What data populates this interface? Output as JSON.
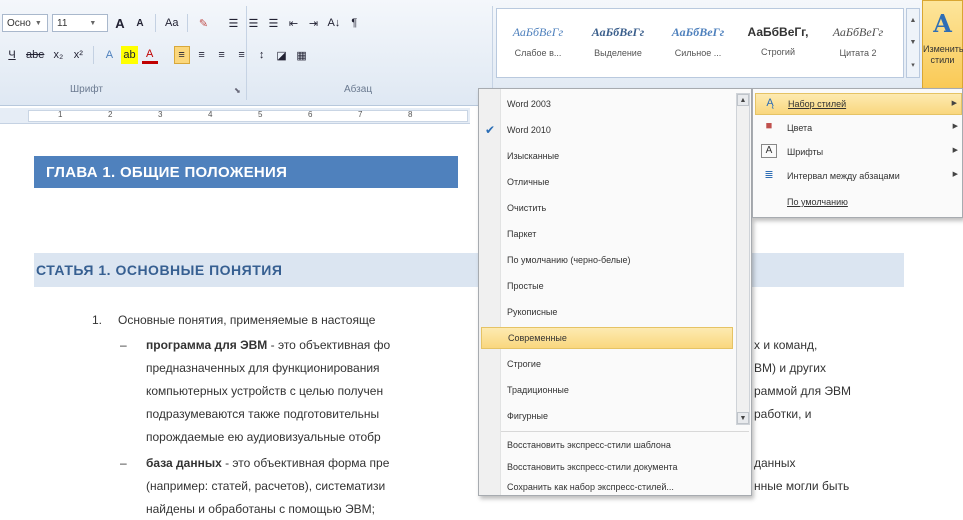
{
  "ribbon": {
    "font_name": "Ocно",
    "font_size": "11",
    "row1_buttons": [
      "A",
      "A",
      "Aa",
      "✎",
      "☰",
      "☰",
      "☰",
      "⇤",
      "⇥",
      "A↓",
      "¶"
    ],
    "row2_buttons": [
      "Ч",
      "abe",
      "x₂",
      "x²",
      "A",
      "ab",
      "A",
      "≡",
      "≡",
      "≡",
      "≡",
      "↕",
      "◪",
      "▦"
    ],
    "group_font_label": "Шрифт",
    "group_paragraph_label": "Абзац"
  },
  "gallery": {
    "items": [
      {
        "preview": "АаБбВеГг",
        "name": "Слабое в..."
      },
      {
        "preview": "АаБбВеГг",
        "name": "Выделение"
      },
      {
        "preview": "АаБбВеГг",
        "name": "Сильное ..."
      },
      {
        "preview": "АаБбВеГг,",
        "name": "Строгий"
      },
      {
        "preview": "АаБбВеГг",
        "name": "Цитата 2"
      }
    ]
  },
  "change_styles": {
    "label": "Изменить стили"
  },
  "ruler": {
    "ticks": [
      "1",
      "2",
      "3",
      "4",
      "5",
      "6",
      "7",
      "8"
    ]
  },
  "document": {
    "heading1": "ГЛАВА 1. ОБЩИЕ ПОЛОЖЕНИЯ",
    "heading2": "СТАТЬЯ 1. ОСНОВНЫЕ ПОНЯТИЯ",
    "item_number": "1.",
    "item_text": "Основные понятия, применяемые в настояще",
    "bullet1_term": "программа для ЭВМ",
    "bullet1_line1_rest": " - это объективная фо",
    "bullet1_line1_right": "х и команд,",
    "bullet1_line2": "предназначенных для функционирования",
    "bullet1_line2_right": "ВМ) и других",
    "bullet1_line3": "компьютерных устройств с целью получен",
    "bullet1_line3_right": "раммой для ЭВМ",
    "bullet1_line4": "подразумеваются также подготовительны",
    "bullet1_line4_right": "работки, и",
    "bullet1_line5": "порождаемые ею аудиовизуальные отобр",
    "bullet2_term": "база данных",
    "bullet2_line1_rest": " - это объективная форма пре",
    "bullet2_line1_right": "данных",
    "bullet2_line2": "(например: статей, расчетов), систематизи",
    "bullet2_line2_right": "нные могли быть",
    "bullet2_line3": "найдены и обработаны с помощью ЭВМ;",
    "dash": "–"
  },
  "style_menu": {
    "items": [
      "Word 2003",
      "Word 2010",
      "Изысканные",
      "Отличные",
      "Очистить",
      "Паркет",
      "По умолчанию (черно-белые)",
      "Простые",
      "Рукописные",
      "Современные",
      "Строгие",
      "Традиционные",
      "Фигурные"
    ],
    "checked_item": "Word 2010",
    "highlighted_item": "Современные",
    "actions": [
      "Восстановить экспресс-стили шаблона",
      "Восстановить экспресс-стили документа",
      "Сохранить как набор экспресс-стилей..."
    ]
  },
  "submenu": {
    "items": [
      {
        "label": "Набор стилей",
        "icon": "style-set-icon",
        "has_arrow": true
      },
      {
        "label": "Цвета",
        "icon": "colors-icon",
        "has_arrow": true
      },
      {
        "label": "Шрифты",
        "icon": "fonts-icon",
        "has_arrow": true
      },
      {
        "label": "Интервал между абзацами",
        "icon": "paragraph-spacing-icon",
        "has_arrow": true
      },
      {
        "label": "По умолчанию",
        "icon": "",
        "has_arrow": false
      }
    ]
  },
  "colors": {
    "heading1_bg": "#4f81bd",
    "heading2_bg": "#dbe5f1",
    "heading2_text": "#365f91",
    "menu_highlight": "#f9d77e"
  }
}
